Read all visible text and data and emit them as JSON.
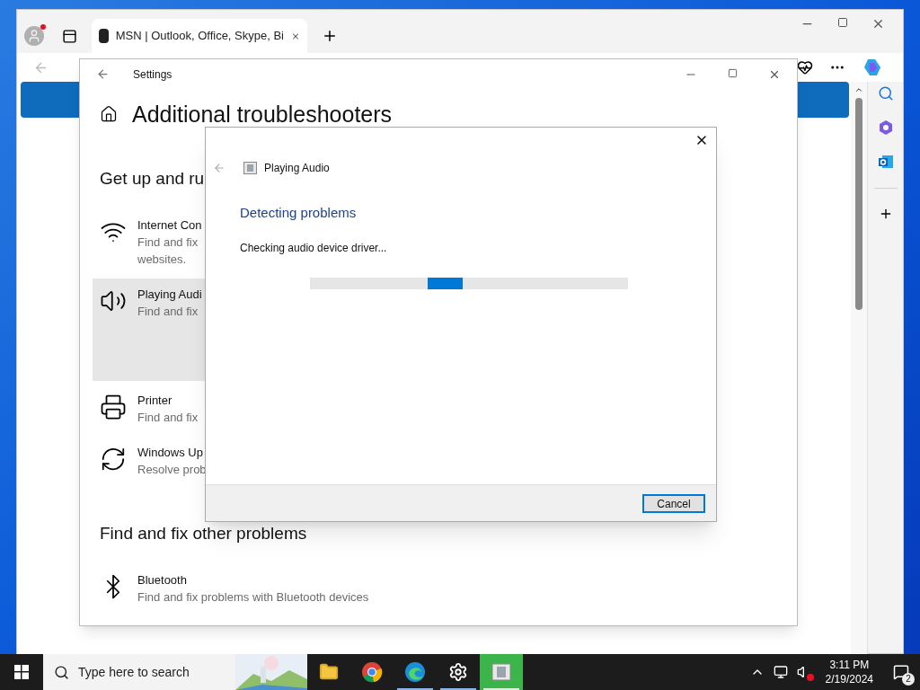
{
  "browser": {
    "tab": {
      "title": "MSN | Outlook, Office, Skype, Bi",
      "selected": true
    },
    "profile_notification": true
  },
  "settings": {
    "title": "Settings",
    "heading": "Additional troubleshooters",
    "sections": [
      {
        "title": "Get up and ru",
        "items": [
          {
            "kind": "wifi",
            "name": "Internet Con",
            "description_lines": [
              "Find and fix",
              "websites."
            ],
            "selected": false
          },
          {
            "kind": "speaker",
            "name": "Playing Audi",
            "description_lines": [
              "Find and fix"
            ],
            "selected": true
          },
          {
            "kind": "printer",
            "name": "Printer",
            "description_lines": [
              "Find and fix"
            ],
            "selected": false
          },
          {
            "kind": "sync",
            "name": "Windows Up",
            "description_lines": [
              "Resolve prob"
            ],
            "selected": false
          }
        ]
      },
      {
        "title": "Find and fix other problems",
        "items": [
          {
            "kind": "bluetooth",
            "name": "Bluetooth",
            "description_lines": [
              "Find and fix problems with Bluetooth devices"
            ],
            "selected": false
          }
        ]
      }
    ]
  },
  "dialog": {
    "title": "Playing Audio",
    "heading": "Detecting problems",
    "status": "Checking audio device driver...",
    "progress_indeterminate": true,
    "button": "Cancel"
  },
  "taskbar": {
    "search_placeholder": "Type here to search",
    "apps": [
      {
        "kind": "explorer",
        "running": false,
        "active": false
      },
      {
        "kind": "chrome",
        "running": false,
        "active": false
      },
      {
        "kind": "edge",
        "running": true,
        "active": false
      },
      {
        "kind": "settings",
        "running": true,
        "active": false
      },
      {
        "kind": "troubleshooter",
        "running": true,
        "active": true
      }
    ],
    "volume_muted": true,
    "time": "3:11 PM",
    "date": "2/19/2024",
    "notifications": "2"
  }
}
